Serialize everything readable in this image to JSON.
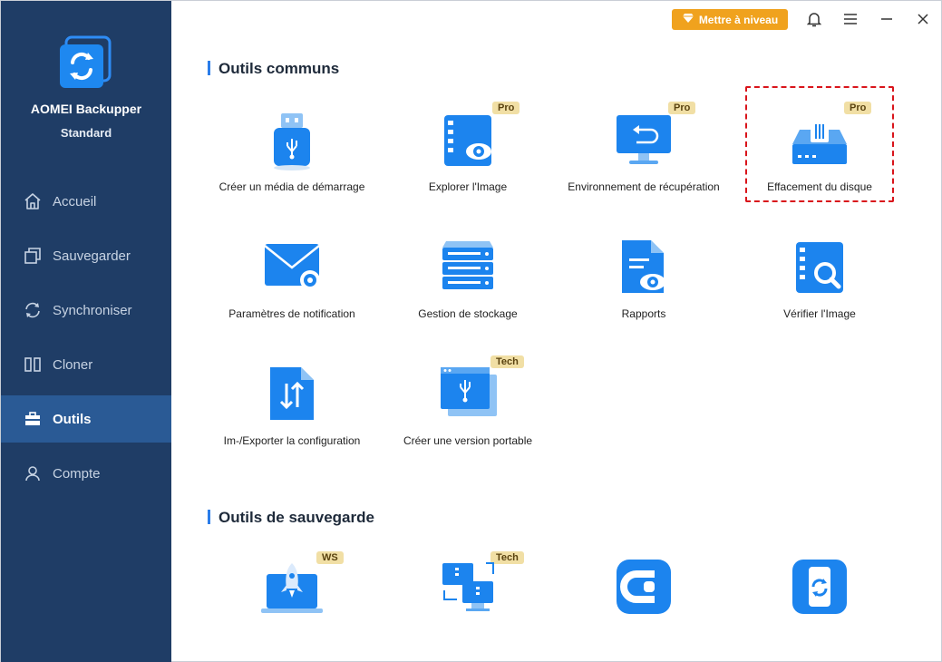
{
  "app": {
    "name": "AOMEI Backupper",
    "edition": "Standard"
  },
  "topbar": {
    "upgrade_label": "Mettre à niveau"
  },
  "sidebar": {
    "items": [
      {
        "label": "Accueil"
      },
      {
        "label": "Sauvegarder"
      },
      {
        "label": "Synchroniser"
      },
      {
        "label": "Cloner"
      },
      {
        "label": "Outils"
      },
      {
        "label": "Compte"
      }
    ],
    "active": "Outils"
  },
  "sections": {
    "common": {
      "title": "Outils communs",
      "tools": [
        {
          "label": "Créer un média de démarrage",
          "badge": ""
        },
        {
          "label": "Explorer l'Image",
          "badge": "Pro"
        },
        {
          "label": "Environnement de récupération",
          "badge": "Pro"
        },
        {
          "label": "Effacement du disque",
          "badge": "Pro"
        },
        {
          "label": "Paramètres de notification",
          "badge": ""
        },
        {
          "label": "Gestion de stockage",
          "badge": ""
        },
        {
          "label": "Rapports",
          "badge": ""
        },
        {
          "label": "Vérifier l'Image",
          "badge": ""
        },
        {
          "label": "Im-/Exporter la configuration",
          "badge": ""
        },
        {
          "label": "Créer une version portable",
          "badge": "Tech"
        }
      ]
    },
    "backup": {
      "title": "Outils de sauvegarde",
      "tools": [
        {
          "badge": "WS"
        },
        {
          "badge": "Tech"
        },
        {
          "badge": ""
        },
        {
          "badge": ""
        }
      ]
    }
  },
  "colors": {
    "sidebar": "#1f3d66",
    "sidebar_active": "#2a5a95",
    "accent": "#2b7de9",
    "upgrade": "#f0a21e",
    "badge": "#f1dfa5",
    "highlight": "#d9141b"
  }
}
